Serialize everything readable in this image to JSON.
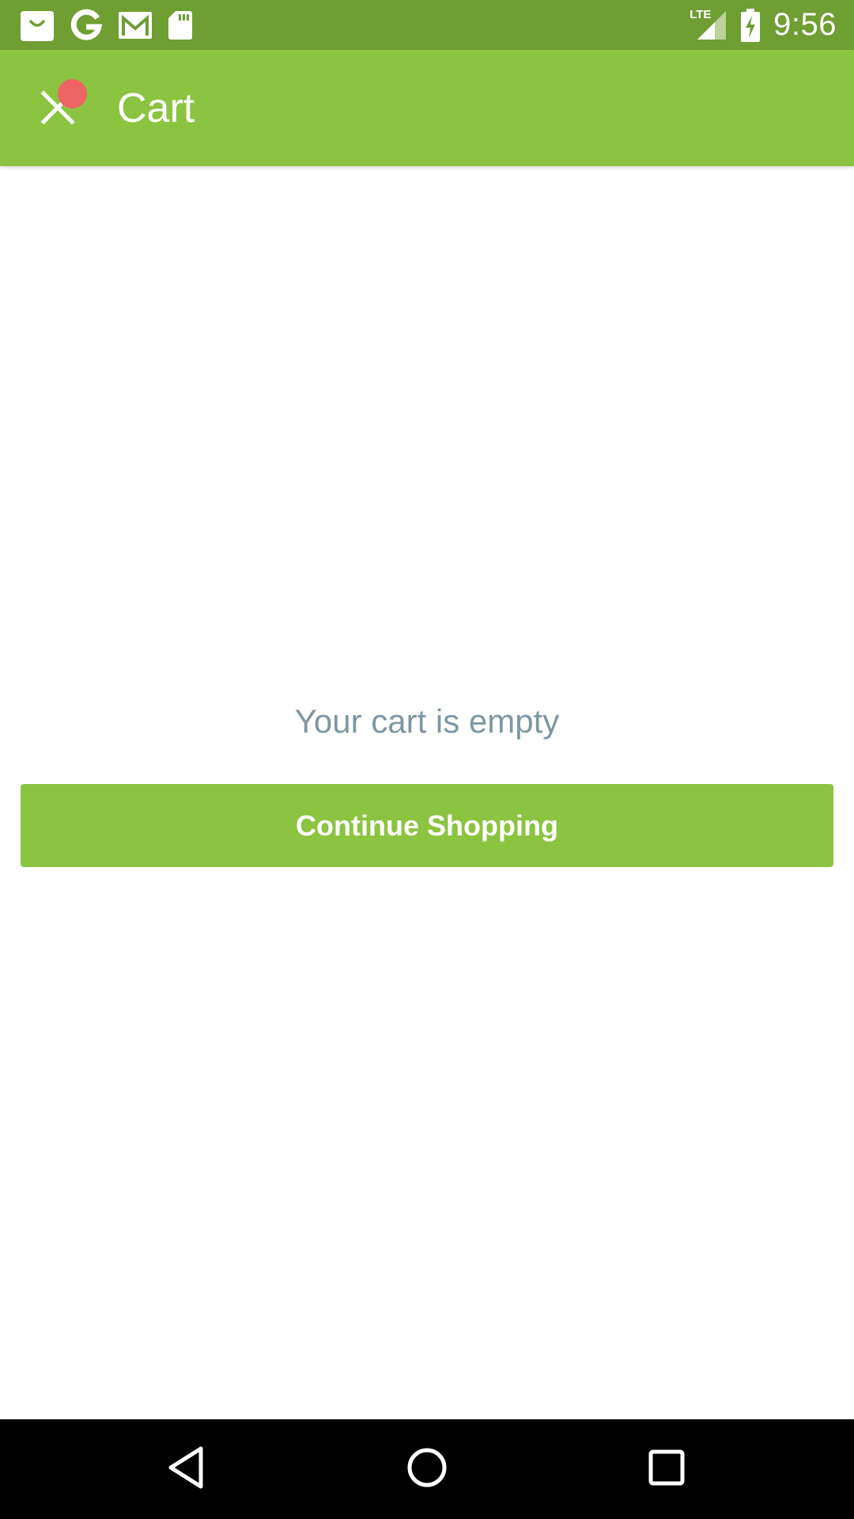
{
  "status_bar": {
    "time": "9:56",
    "network_label": "LTE",
    "icons_left": [
      "shopping-bag-icon",
      "google-icon",
      "gmail-icon",
      "sd-card-icon"
    ],
    "icons_right": [
      "lte-signal-icon",
      "battery-charging-icon"
    ]
  },
  "toolbar": {
    "title": "Cart",
    "close_icon": "close-icon",
    "badge_color": "#ee6464"
  },
  "main": {
    "empty_message": "Your cart is empty",
    "continue_button_label": "Continue Shopping"
  },
  "nav_bar": {
    "icons": [
      "back-icon",
      "home-icon",
      "recents-icon"
    ]
  },
  "colors": {
    "status_bar": "#6f9e33",
    "accent": "#8bc441",
    "muted_text": "#7e97a2",
    "badge": "#ee6464"
  }
}
